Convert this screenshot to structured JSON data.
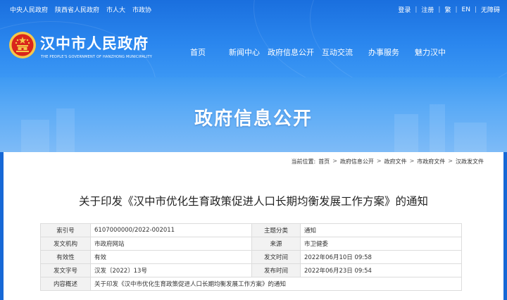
{
  "topbar": {
    "left_links": [
      "中央人民政府",
      "陕西省人民政府",
      "市人大",
      "市政协"
    ],
    "right_links": [
      "登录",
      "注册",
      "繁",
      "EN",
      "无障碍"
    ]
  },
  "site": {
    "title": "汉中市人民政府",
    "subtitle": "THE PEOPLE'S GOVERNMENT OF HANZHONG MUNICIPALITY"
  },
  "nav": [
    "首页",
    "新闻中心",
    "政府信息公开",
    "互动交流",
    "办事服务",
    "魅力汉中"
  ],
  "banner": {
    "title": "政府信息公开"
  },
  "breadcrumb": {
    "label": "当前位置:",
    "items": [
      "首页",
      "政府信息公开",
      "政府文件",
      "市政府文件",
      "汉政发文件"
    ],
    "arrow": ">"
  },
  "article": {
    "title": "关于印发《汉中市优化生育政策促进人口长期均衡发展工作方案》的通知",
    "meta": {
      "rows": [
        [
          "索引号",
          "6107000000/2022-002011",
          "主题分类",
          "通知"
        ],
        [
          "发文机构",
          "市政府网站",
          "来源",
          "市卫健委"
        ],
        [
          "有效性",
          "有效",
          "发文时间",
          "2022年06月10日 09:58"
        ],
        [
          "发文字号",
          "汉发〔2022〕13号",
          "发布时间",
          "2022年06月23日 09:54"
        ]
      ],
      "summary_label": "内容概述",
      "summary_value": "关于印发《汉中市优化生育政策促进人口长期均衡发展工作方案》的通知"
    }
  },
  "colors": {
    "header_blue": "#1a6fde",
    "banner_blue": "#5aaaf6",
    "emblem_red": "#d9251c",
    "emblem_gold": "#f5c84a"
  }
}
